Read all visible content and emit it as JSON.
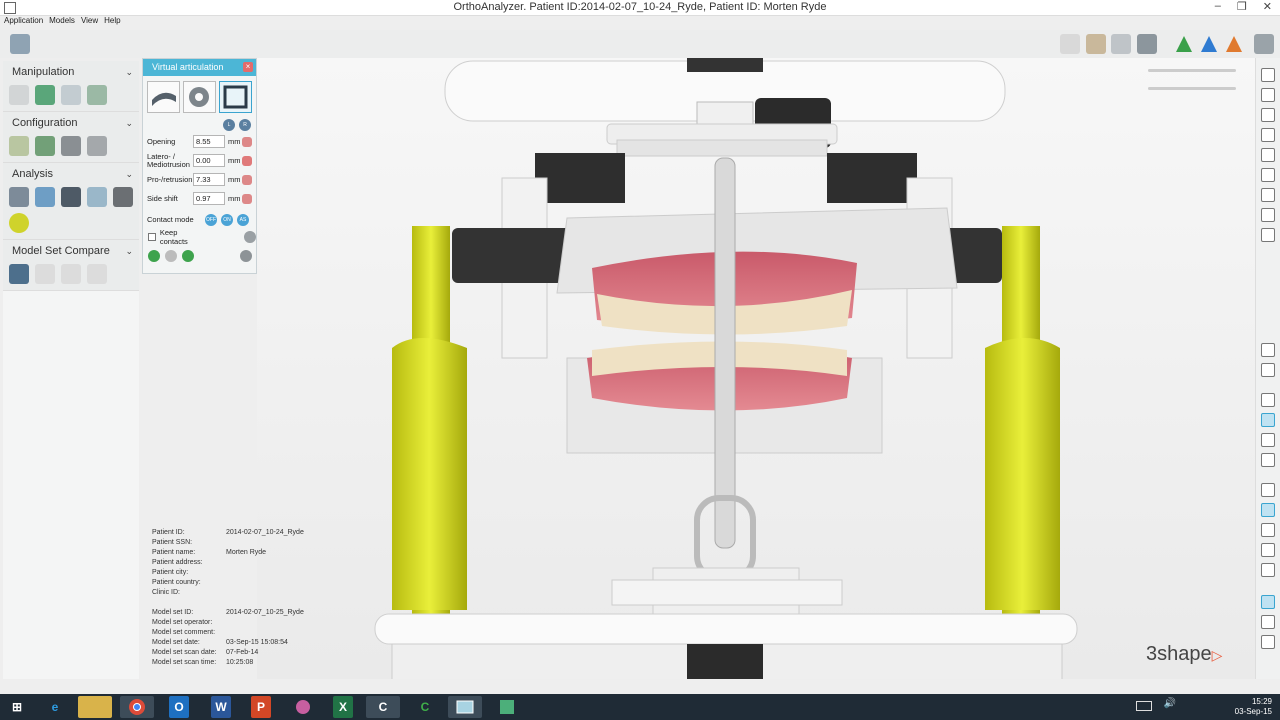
{
  "window": {
    "title": "OrthoAnalyzer. Patient ID:2014-02-07_10-24_Ryde, Patient ID: Morten Ryde",
    "minimize": "‒",
    "restore": "❐",
    "close": "✕"
  },
  "menu": [
    "Application",
    "Models",
    "View",
    "Help"
  ],
  "left_panel": {
    "sections": [
      {
        "label": "Manipulation",
        "icons": [
          "move-icon",
          "rotate-icon",
          "align-icon",
          "swap-icon"
        ]
      },
      {
        "label": "Configuration",
        "icons": [
          "axis-icon",
          "base-icon",
          "hourglass-icon",
          "tooth-icon"
        ]
      },
      {
        "label": "Analysis",
        "icons": [
          "ruler-icon",
          "graph-icon",
          "plane-icon",
          "cube-icon",
          "scanner-icon",
          "marker-icon"
        ]
      },
      {
        "label": "Model Set Compare",
        "icons": [
          "compare-icon",
          "wand-icon",
          "brush-icon",
          "model-icon"
        ]
      }
    ]
  },
  "virtual_articulation": {
    "title": "Virtual articulation",
    "close": "×",
    "fields": [
      {
        "label": "Opening",
        "value": "8.55",
        "unit": "mm"
      },
      {
        "label": "Latero- / Mediotrusion",
        "value": "0.00",
        "unit": "mm"
      },
      {
        "label": "Pro-/retrusion",
        "value": "7.33",
        "unit": "mm"
      },
      {
        "label": "Side shift",
        "value": "0.97",
        "unit": "mm"
      }
    ],
    "contact_mode_label": "Contact mode",
    "contact_mode_options": [
      "OFF",
      "ON",
      "AS"
    ],
    "keep_contacts_label": "Keep contacts",
    "side_toggle": [
      "L",
      "R"
    ]
  },
  "patient_info": [
    {
      "k": "Patient ID:",
      "v": "2014-02-07_10-24_Ryde"
    },
    {
      "k": "Patient SSN:",
      "v": ""
    },
    {
      "k": "Patient name:",
      "v": "Morten Ryde"
    },
    {
      "k": "Patient address:",
      "v": ""
    },
    {
      "k": "Patient city:",
      "v": ""
    },
    {
      "k": "Patient country:",
      "v": ""
    },
    {
      "k": "Clinic ID:",
      "v": ""
    },
    {
      "k": "",
      "v": ""
    },
    {
      "k": "Model set ID:",
      "v": "2014-02-07_10-25_Ryde"
    },
    {
      "k": "Model set operator:",
      "v": ""
    },
    {
      "k": "Model set comment:",
      "v": ""
    },
    {
      "k": "Model set date:",
      "v": "03-Sep-15 15:08:54"
    },
    {
      "k": "Model set scan date:",
      "v": "07-Feb-14"
    },
    {
      "k": "Model set scan time:",
      "v": "10:25:08"
    }
  ],
  "brand": {
    "name": "3shape",
    "mark": "▷"
  },
  "taskbar": {
    "items": [
      "start-icon",
      "ie-icon",
      "explorer-icon",
      "chrome-icon",
      "outlook-icon",
      "word-icon",
      "powerpoint-icon",
      "paint-icon",
      "excel-icon",
      "camtasia-icon",
      "camtasia-recorder-icon",
      "orthoanalyzer-icon",
      "app-icon"
    ],
    "time": "15:29",
    "date": "03-Sep-15"
  }
}
